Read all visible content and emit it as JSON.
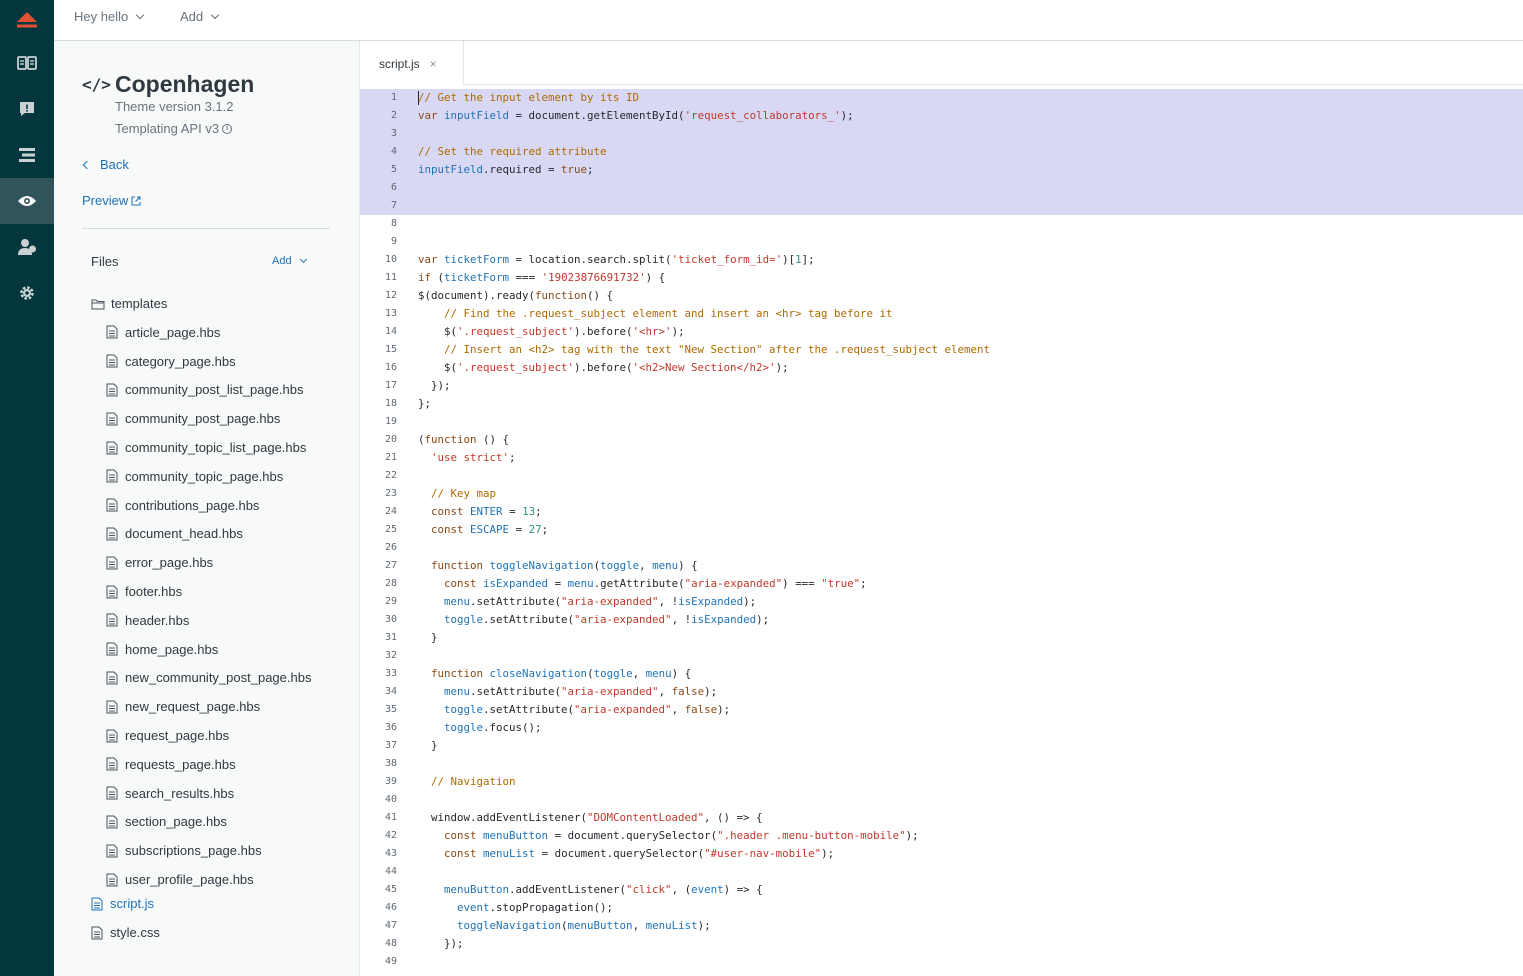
{
  "topbar": {
    "account_label": "Hey hello",
    "add_label": "Add"
  },
  "theme": {
    "name": "Copenhagen",
    "version": "Theme version 3.1.2",
    "api": "Templating API v3"
  },
  "nav": {
    "back_label": "Back",
    "preview_label": "Preview"
  },
  "files": {
    "label": "Files",
    "add_label": "Add",
    "folder": "templates",
    "templates": [
      "article_page.hbs",
      "category_page.hbs",
      "community_post_list_page.hbs",
      "community_post_page.hbs",
      "community_topic_list_page.hbs",
      "community_topic_page.hbs",
      "contributions_page.hbs",
      "document_head.hbs",
      "error_page.hbs",
      "footer.hbs",
      "header.hbs",
      "home_page.hbs",
      "new_community_post_page.hbs",
      "new_request_page.hbs",
      "request_page.hbs",
      "requests_page.hbs",
      "search_results.hbs",
      "section_page.hbs",
      "subscriptions_page.hbs",
      "user_profile_page.hbs"
    ],
    "root": [
      "script.js",
      "style.css"
    ],
    "active_file": "script.js"
  },
  "editor": {
    "tab_label": "script.js",
    "tab_close": "×",
    "lines": [
      "// Get the input element by its ID",
      "var inputField = document.getElementById('request_collaborators_');",
      "",
      "// Set the required attribute",
      "inputField.required = true;",
      "",
      "",
      "",
      "",
      "var ticketForm = location.search.split('ticket_form_id=')[1];",
      "if (ticketForm === '19023876691732') {",
      "$(document).ready(function() {",
      "    // Find the .request_subject element and insert an <hr> tag before it",
      "    $('.request_subject').before('<hr>');",
      "    // Insert an <h2> tag with the text \"New Section\" after the .request_subject element",
      "    $('.request_subject').before('<h2>New Section</h2>');",
      "  });",
      "};",
      "",
      "(function () {",
      "  'use strict';",
      "",
      "  // Key map",
      "  const ENTER = 13;",
      "  const ESCAPE = 27;",
      "",
      "  function toggleNavigation(toggle, menu) {",
      "    const isExpanded = menu.getAttribute(\"aria-expanded\") === \"true\";",
      "    menu.setAttribute(\"aria-expanded\", !isExpanded);",
      "    toggle.setAttribute(\"aria-expanded\", !isExpanded);",
      "  }",
      "",
      "  function closeNavigation(toggle, menu) {",
      "    menu.setAttribute(\"aria-expanded\", false);",
      "    toggle.setAttribute(\"aria-expanded\", false);",
      "    toggle.focus();",
      "  }",
      "",
      "  // Navigation",
      "",
      "  window.addEventListener(\"DOMContentLoaded\", () => {",
      "    const menuButton = document.querySelector(\".header .menu-button-mobile\");",
      "    const menuList = document.querySelector(\"#user-nav-mobile\");",
      "",
      "    menuButton.addEventListener(\"click\", (event) => {",
      "      event.stopPropagation();",
      "      toggleNavigation(menuButton, menuList);",
      "    });",
      ""
    ],
    "selected_lines": 7
  },
  "colors": {
    "rail": "#03363d",
    "rail_active": "#30545a",
    "logo": "#e34f32",
    "link": "#1f73b7",
    "selection": "#d9d8f4"
  }
}
